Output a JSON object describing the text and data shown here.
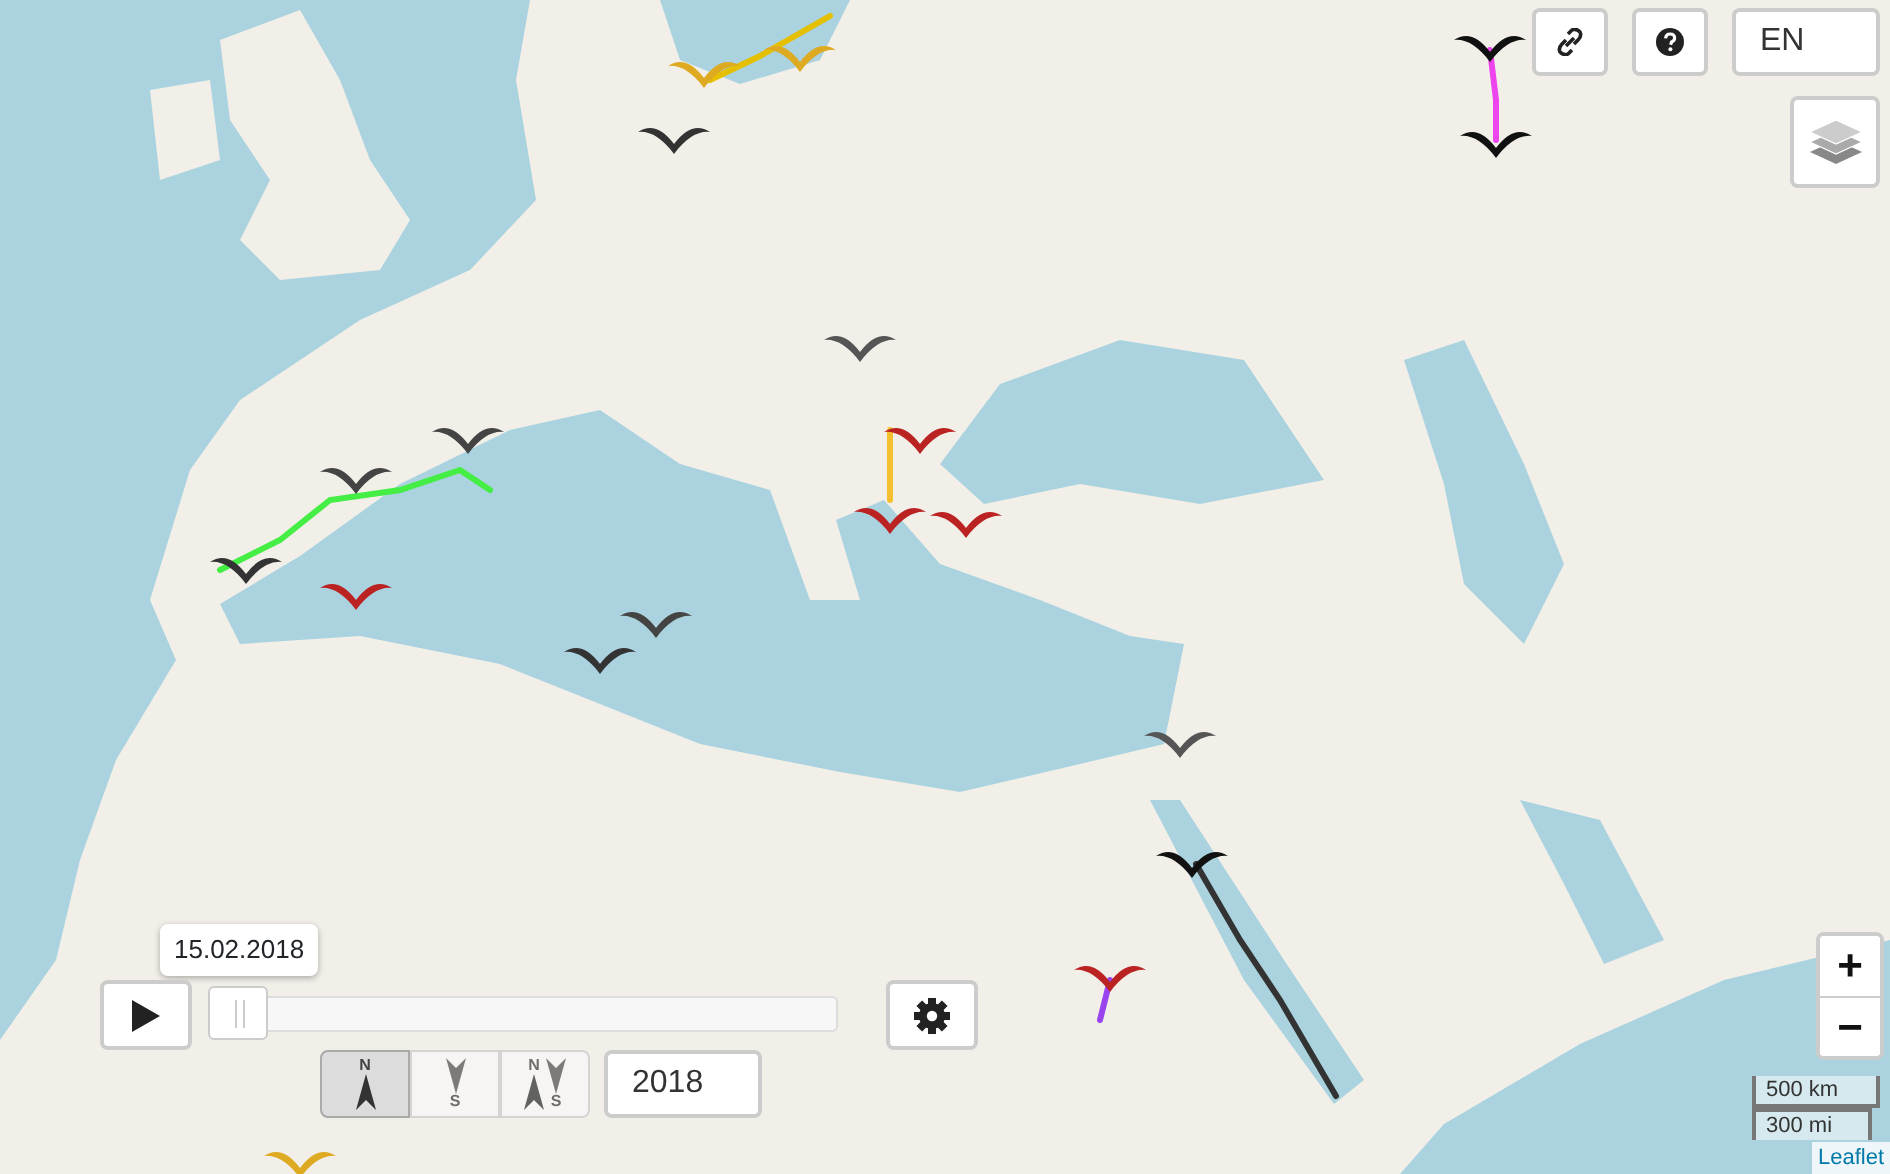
{
  "top_controls": {
    "language": "EN"
  },
  "timeline": {
    "date": "15.02.2018",
    "level": 0.0
  },
  "direction_modes": [
    {
      "kind": "north",
      "labels": [
        "N"
      ],
      "selected": true
    },
    {
      "kind": "south",
      "labels": [
        "S"
      ],
      "selected": false
    },
    {
      "kind": "both",
      "labels": [
        "N",
        "S"
      ],
      "selected": false
    }
  ],
  "year": "2018",
  "zoom": {
    "zoom_in": "+",
    "zoom_out": "−"
  },
  "scale": [
    "500 km",
    "300 mi"
  ],
  "attribution": "Leaflet"
}
